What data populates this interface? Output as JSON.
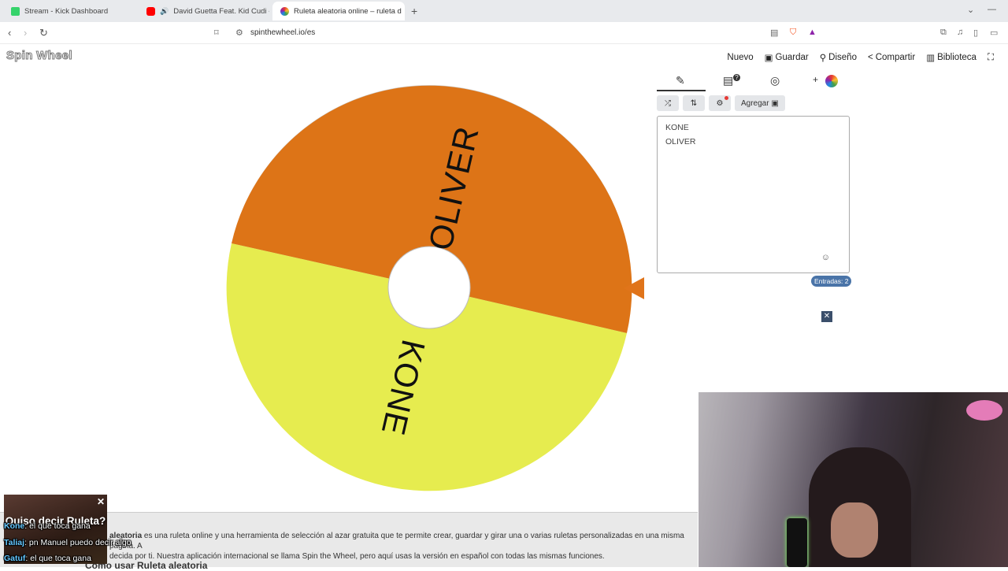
{
  "browser": {
    "tabs": [
      {
        "title": "Stream - Kick Dashboard",
        "active": false
      },
      {
        "title": "David Guetta Feat. Kid Cudi - Me",
        "active": false
      },
      {
        "title": "Ruleta aleatoria online – ruleta d",
        "active": true
      }
    ],
    "url": "spinthewheel.io/es"
  },
  "site": {
    "logo": "Spin Wheel",
    "menu": {
      "new": "Nuevo",
      "save": "Guardar",
      "design": "Diseño",
      "share": "Compartir",
      "library": "Biblioteca"
    }
  },
  "wheel": {
    "segments": [
      {
        "label": "OLIVER",
        "color": "#dd7417"
      },
      {
        "label": "KONE",
        "color": "#e6ec4f"
      }
    ],
    "pointer_color": "#e0741a"
  },
  "panel": {
    "add_button": "Agregar",
    "entries": [
      "KONE",
      "OLIVER"
    ],
    "entries_count": "Entradas: 2"
  },
  "page": {
    "description_bold": "aleatoria",
    "description": " es una ruleta online y una herramienta de selección al azar gratuita que te permite crear, guardar y girar una o varias ruletas personalizadas en una misma página. A",
    "description2": "decida por ti. Nuestra aplicación internacional se llama Spin the Wheel, pero aquí usas la versión en español con todas las mismas funciones.",
    "howto_title": "Cómo usar Ruleta aleatoria"
  },
  "stream_overlay": {
    "title": "Quiso decir Ruleta?",
    "chat": [
      {
        "user": "Kone",
        "message": ": el que toca gana"
      },
      {
        "user": "Taliaj",
        "message": ": pn Manuel puedo decir algo"
      },
      {
        "user": "Gatuf",
        "message": ": el que toca gana"
      }
    ]
  },
  "colors": {
    "accent": "#4a74a8",
    "wheel_orange": "#dd7417",
    "wheel_yellow": "#e6ec4f"
  }
}
